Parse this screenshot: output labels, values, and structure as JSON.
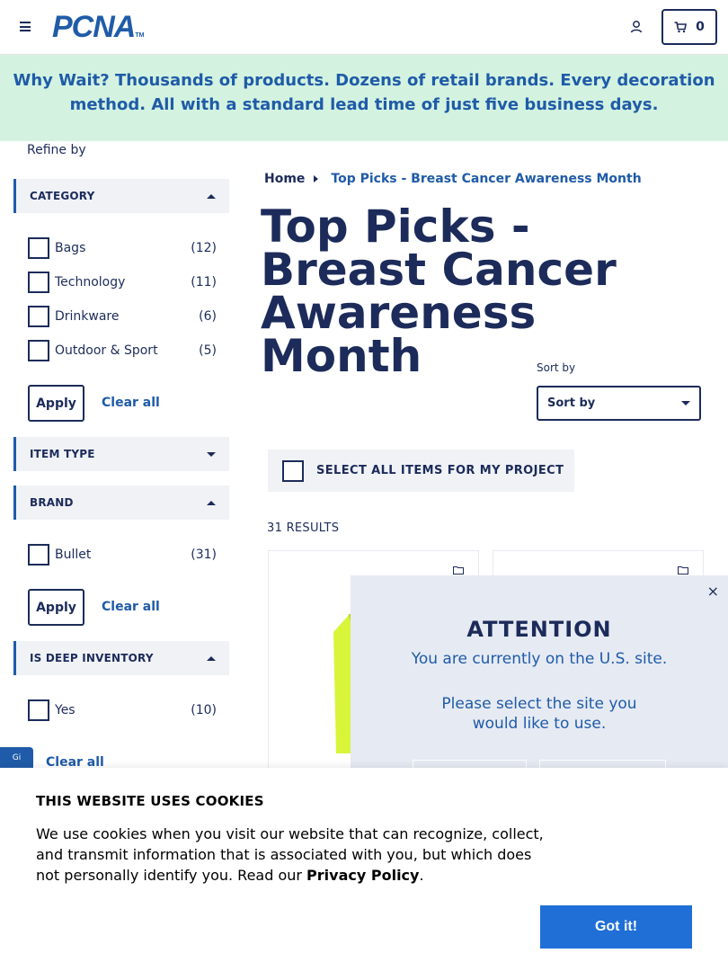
{
  "header": {
    "logo_text": "PCNA",
    "logo_tm": "TM",
    "cart_count": "0"
  },
  "banner": {
    "text_bold": "Why Wait?",
    "text": " Thousands of products. Dozens of retail brands. Every decoration method. All with a standard lead time of just five business days."
  },
  "sidebar": {
    "refine_label": "Refine by",
    "category": {
      "title": "CATEGORY",
      "items": [
        {
          "label": "Bags",
          "count": "(12)"
        },
        {
          "label": "Technology",
          "count": "(11)"
        },
        {
          "label": "Drinkware",
          "count": "(6)"
        },
        {
          "label": "Outdoor & Sport",
          "count": "(5)"
        }
      ],
      "apply": "Apply",
      "clear": "Clear all"
    },
    "item_type": {
      "title": "ITEM TYPE"
    },
    "brand": {
      "title": "BRAND",
      "items": [
        {
          "label": "Bullet",
          "count": "(31)"
        }
      ],
      "apply": "Apply",
      "clear": "Clear all"
    },
    "deep_inventory": {
      "title": "IS DEEP INVENTORY",
      "items": [
        {
          "label": "Yes",
          "count": "(10)"
        }
      ],
      "clear": "Clear all"
    },
    "feedback_tab": "Gi"
  },
  "main": {
    "breadcrumb": {
      "home": "Home",
      "current": "Top Picks - Breast Cancer Awareness Month"
    },
    "title": "Top Picks - Breast Cancer Awareness Month",
    "sort_label": "Sort by",
    "sort_value": "Sort by",
    "select_all": "SELECT ALL ITEMS FOR MY PROJECT",
    "results": "31 RESULTS"
  },
  "modal": {
    "close": "×",
    "heading": "ATTENTION",
    "line1": "You are currently on the U.S. site.",
    "line2": "Please select the site you would like to use."
  },
  "cookie": {
    "heading": "THIS WEBSITE USES COOKIES",
    "text": "We use cookies when you visit our website that can recognize, collect, and transmit information that is associated with you, but which does not personally identify you. Read our ",
    "link": "Privacy Policy",
    "period": ".",
    "button": "Got it!"
  },
  "colors": {
    "navy": "#1c2b5a",
    "brand_blue": "#1f5ba8",
    "banner_bg": "#d3f3e0",
    "button_blue": "#1f6fd6",
    "vest_yellow": "#d8f53a"
  }
}
